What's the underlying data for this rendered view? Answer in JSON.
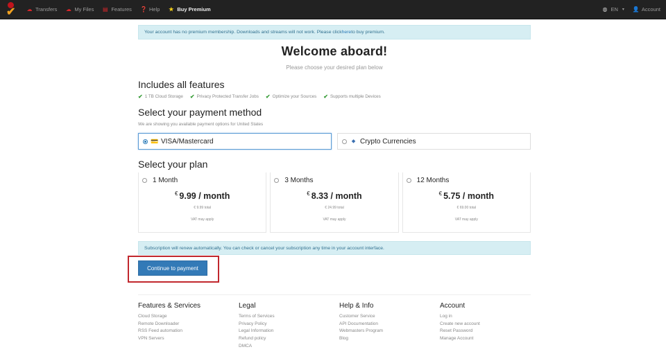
{
  "navbar": {
    "items": [
      {
        "label": "Transfers",
        "icon": "cloud-upload-icon"
      },
      {
        "label": "My Files",
        "icon": "cloud-icon"
      },
      {
        "label": "Features",
        "icon": "list-icon"
      },
      {
        "label": "Help",
        "icon": "question-icon"
      },
      {
        "label": "Buy Premium",
        "icon": "star-icon"
      }
    ],
    "language": "EN",
    "account": "Account"
  },
  "alert_premium": {
    "text_before": "Your account has no premium membership. Downloads and streams will not work. Please click ",
    "link": "here",
    "text_after": " to buy premium."
  },
  "welcome": {
    "title": "Welcome aboard!",
    "subtitle": "Please choose your desired plan below"
  },
  "features": {
    "heading": "Includes all features",
    "items": [
      "1 TB Cloud Storage",
      "Privacy Protected Transfer Jobs",
      "Optimize your Sources",
      "Supports multiple Devices"
    ]
  },
  "payment": {
    "heading": "Select your payment method",
    "note": "We are showing you available payment options for United States",
    "options": [
      {
        "label": "VISA/Mastercard",
        "selected": true
      },
      {
        "label": "Crypto Currencies",
        "selected": false
      }
    ]
  },
  "plans": {
    "heading": "Select your plan",
    "items": [
      {
        "title": "1 Month",
        "currency": "€",
        "price": "9.99 / month",
        "total": "€ 9.99 total",
        "vat": "VAT may apply"
      },
      {
        "title": "3 Months",
        "currency": "€",
        "price": "8.33 / month",
        "total": "€ 24.99 total",
        "vat": "VAT may apply"
      },
      {
        "title": "12 Months",
        "currency": "€",
        "price": "5.75 / month",
        "total": "€ 69.00 total",
        "vat": "VAT may apply"
      }
    ]
  },
  "alert_renew": {
    "text": "Subscription will renew automatically. You can check or cancel your subscription any time in your account interface."
  },
  "continue_label": "Continue to payment",
  "footer": {
    "columns": [
      {
        "heading": "Features & Services",
        "links": [
          "Cloud Storage",
          "Remote Downloader",
          "RSS Feed automation",
          "VPN Servers"
        ]
      },
      {
        "heading": "Legal",
        "links": [
          "Terms of Services",
          "Privacy Policy",
          "Legal Information",
          "Refund policy",
          "DMCA"
        ]
      },
      {
        "heading": "Help & Info",
        "links": [
          "Customer Service",
          "API Documentation",
          "Webmasters Program",
          "Blog"
        ]
      },
      {
        "heading": "Account",
        "links": [
          "Log in",
          "Create new account",
          "Reset Password",
          "Manage Account"
        ]
      }
    ]
  }
}
